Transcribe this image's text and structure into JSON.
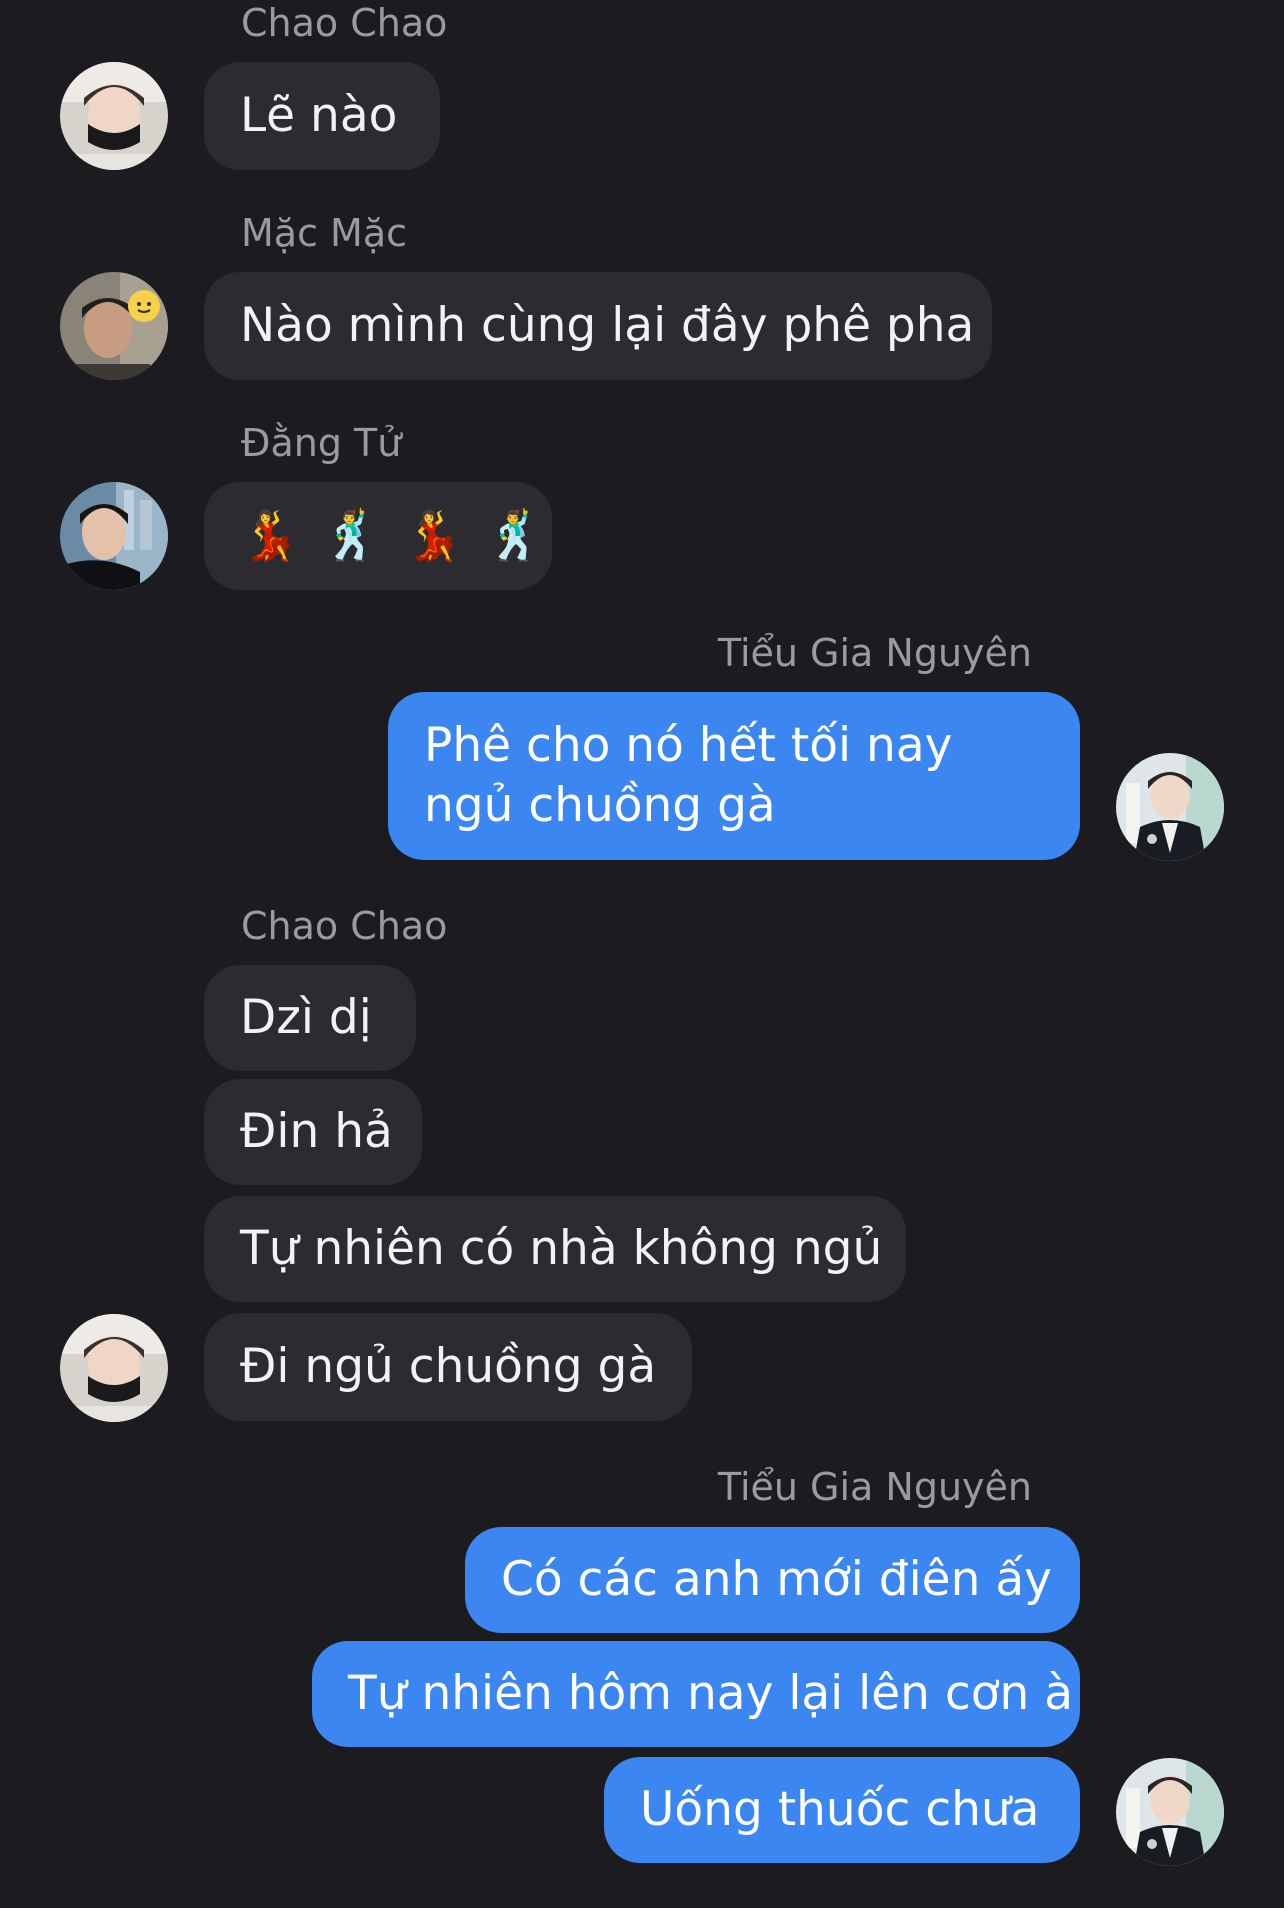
{
  "messages": {
    "m1": {
      "sender": "Chao Chao",
      "text": "Lẽ nào"
    },
    "m2": {
      "sender": "Mặc Mặc",
      "text": "Nào mình cùng lại đây phê pha"
    },
    "m3": {
      "sender": "Đằng Tử",
      "emoji": [
        "💃",
        "🕺",
        "💃",
        "🕺"
      ]
    },
    "m4": {
      "sender": "Tiểu Gia Nguyên",
      "text": "Phê cho nó hết tối nay ngủ chuồng gà"
    },
    "m5": {
      "sender": "Chao Chao",
      "texts": [
        "Dzì dị",
        "Đin hả",
        "Tự nhiên có nhà không ngủ",
        "Đi ngủ chuồng gà"
      ]
    },
    "m6": {
      "sender": "Tiểu Gia Nguyên",
      "texts": [
        "Có các anh mới điên ấy",
        "Tự nhiên hôm nay lại lên cơn à",
        "Uống thuốc chưa"
      ]
    }
  },
  "colors": {
    "background": "#1c1c20",
    "incoming_bubble": "#2b2b30",
    "outgoing_bubble": "#3b86f0",
    "sender_name": "#9a9aa0"
  },
  "icons": {
    "avatar_chao": "avatar-chao-icon",
    "avatar_mac": "avatar-mac-icon",
    "avatar_dang": "avatar-dang-icon",
    "avatar_tieu": "avatar-tieu-icon"
  }
}
